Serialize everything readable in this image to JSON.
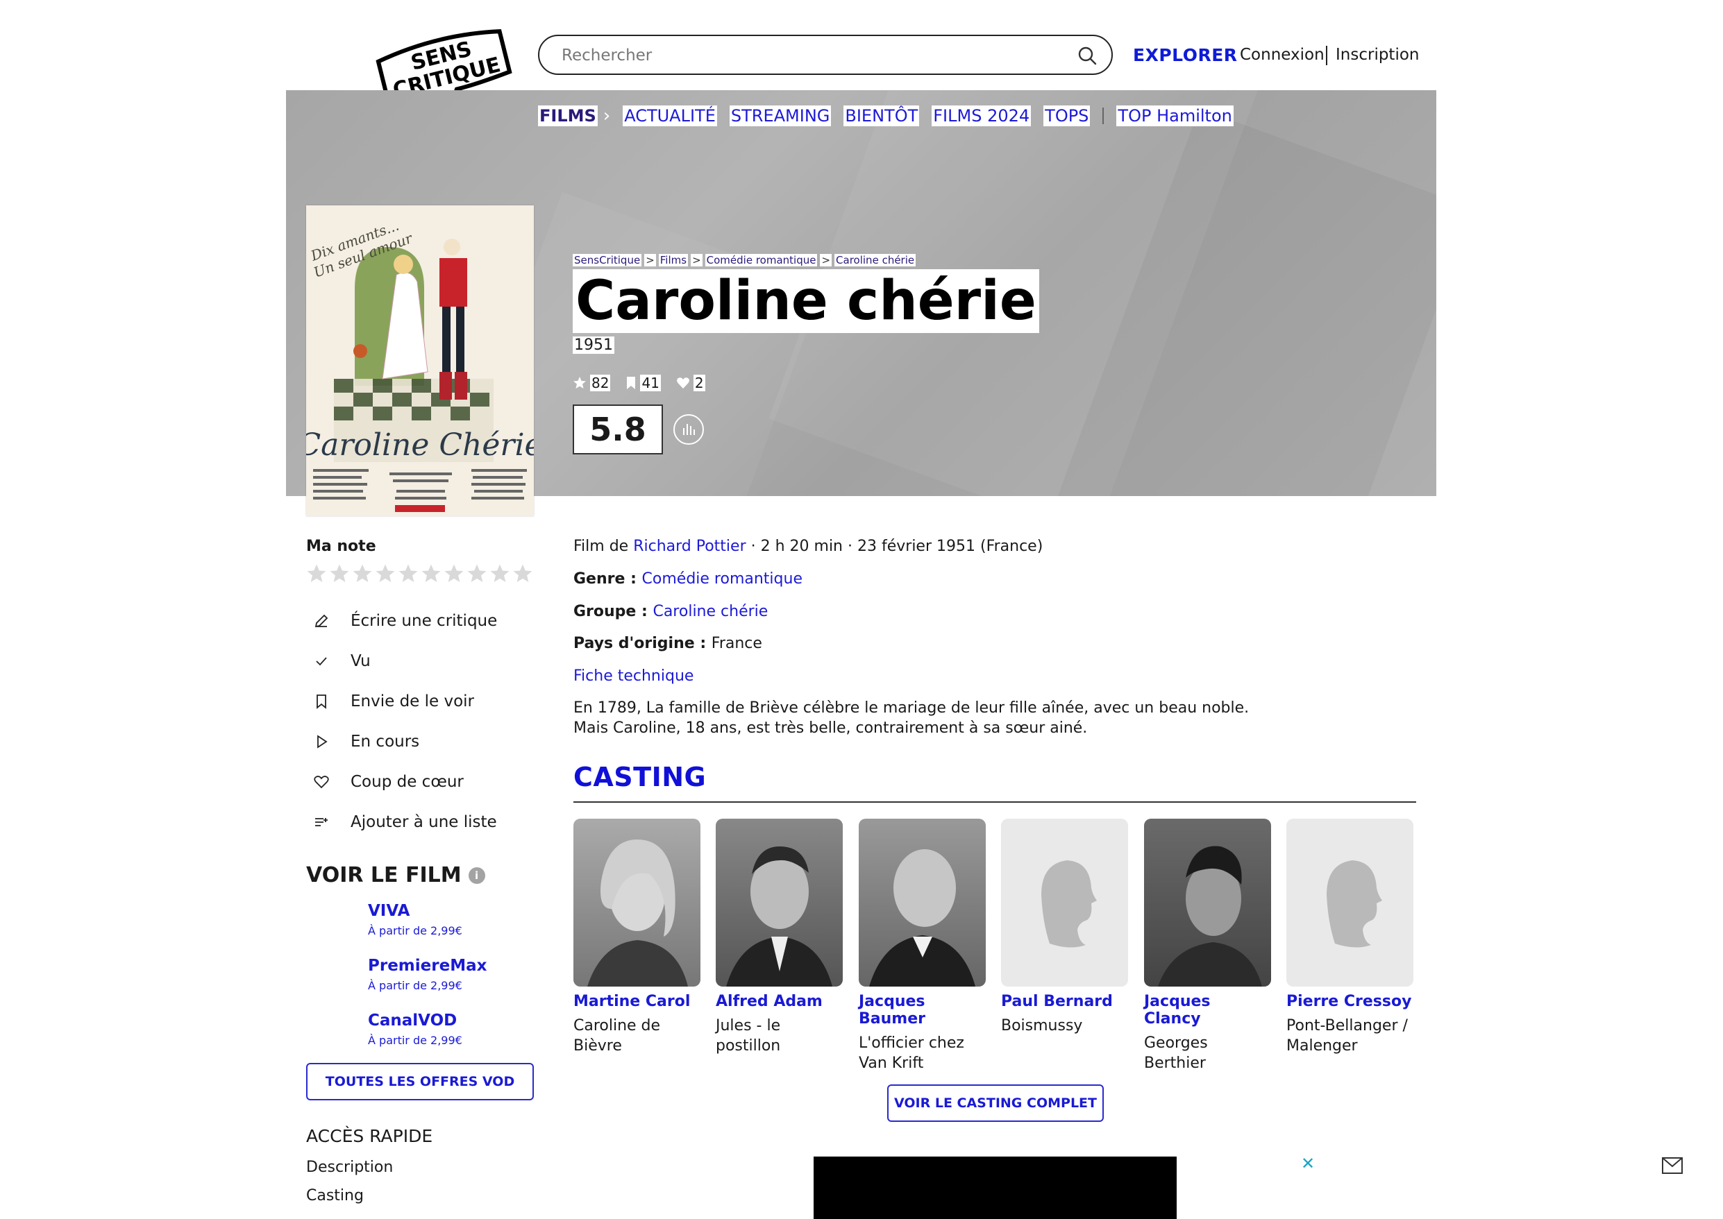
{
  "header": {
    "logo_line1": "SENS",
    "logo_line2": "CRITIQUE",
    "search_placeholder": "Rechercher",
    "explorer": "EXPLORER",
    "connexion": "Connexion",
    "inscription": "Inscription"
  },
  "nav": {
    "items": [
      "FILMS",
      "ACTUALITÉ",
      "STREAMING",
      "BIENTÔT",
      "FILMS 2024",
      "TOPS",
      "TOP Hamilton"
    ]
  },
  "breadcrumb": [
    "SensCritique",
    "Films",
    "Comédie romantique",
    "Caroline chérie"
  ],
  "film": {
    "title": "Caroline chérie",
    "year": "1951",
    "ratings_count": "82",
    "wishlist_count": "41",
    "favorites_count": "2",
    "score": "5.8",
    "poster": {
      "tagline_1": "Dix amants...",
      "tagline_2": "Un seul amour",
      "title": "Caroline Chérie"
    }
  },
  "sidebar": {
    "ma_note": "Ma note",
    "rating_max": 10,
    "actions": [
      "Écrire une critique",
      "Vu",
      "Envie de le voir",
      "En cours",
      "Coup de cœur",
      "Ajouter à une liste"
    ],
    "voir_le_film": "VOIR LE FILM",
    "info_mark": "i",
    "vod": [
      {
        "name": "VIVA",
        "price": "À partir de 2,99€"
      },
      {
        "name": "PremiereMax",
        "price": "À partir de 2,99€"
      },
      {
        "name": "CanalVOD",
        "price": "À partir de 2,99€"
      }
    ],
    "all_vod_button": "TOUTES LES OFFRES VOD",
    "acces_rapide": "ACCÈS RAPIDE",
    "quick_links": [
      "Description",
      "Casting"
    ]
  },
  "details": {
    "film_de_prefix": "Film de ",
    "director": "Richard Pottier",
    "meta": " · 2 h 20 min · 23 février 1951 (France)",
    "genre_label": "Genre : ",
    "genre": "Comédie romantique",
    "groupe_label": "Groupe : ",
    "groupe": "Caroline chérie",
    "pays_label": "Pays d'origine : ",
    "pays": "France",
    "fiche_technique": "Fiche technique",
    "synopsis_line1": "En 1789, La famille de Briève célèbre le mariage de leur fille aînée, avec un beau noble.",
    "synopsis_line2": "Mais Caroline, 18 ans, est très belle, contrairement à sa sœur ainé."
  },
  "casting": {
    "heading": "CASTING",
    "actors": [
      {
        "name": "Martine Carol",
        "role": "Caroline de Bièvre"
      },
      {
        "name": "Alfred Adam",
        "role": "Jules - le postillon"
      },
      {
        "name": "Jacques Baumer",
        "role": "L'officier chez Van Krift"
      },
      {
        "name": "Paul Bernard",
        "role": "Boismussy"
      },
      {
        "name": "Jacques Clancy",
        "role": "Georges Berthier"
      },
      {
        "name": "Pierre Cressoy",
        "role": "Pont-Bellanger / Malenger"
      }
    ],
    "voir_button": "VOIR LE CASTING COMPLET"
  },
  "ad": {
    "close": "✕"
  },
  "colors": {
    "accent": "#1a1ad4",
    "banner": "#a9a9a9",
    "ad_close": "#19a6c3"
  }
}
